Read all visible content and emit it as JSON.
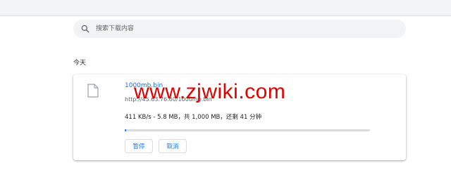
{
  "search": {
    "placeholder": "搜索下载内容",
    "icon": "search-icon"
  },
  "section": {
    "date": "今天"
  },
  "download": {
    "filename": "1000mb.bin",
    "url": "http://45.63.76.60/1000mb.bin",
    "progress_text": "411 KB/s - 5.8 MB，共 1,000 MB，还剩 41 分钟",
    "progress_fraction": 0.006,
    "pause_label": "暂停",
    "cancel_label": "取消",
    "icon": "file-icon"
  },
  "watermark": {
    "text": "www.zjwiki.com"
  },
  "colors": {
    "accent": "#1a73e8",
    "watermark": "#e00000",
    "search_bg": "#f1f3f4"
  }
}
